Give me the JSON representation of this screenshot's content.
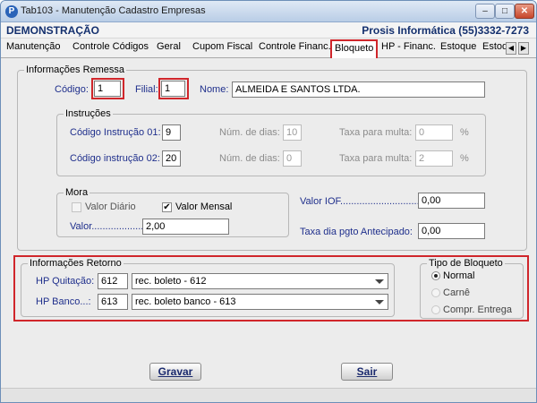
{
  "window": {
    "app_icon": "P",
    "title": "Tab103 - Manutenção Cadastro Empresas",
    "minimize": "–",
    "maximize": "□",
    "close": "✕"
  },
  "header": {
    "environment": "DEMONSTRAÇÃO",
    "company": "Prosis Informática (55)3332-7273"
  },
  "tabs": [
    {
      "label": "Manutenção"
    },
    {
      "label": "Controle Códigos"
    },
    {
      "label": "Geral"
    },
    {
      "label": "Cupom Fiscal"
    },
    {
      "label": "Controle Financ."
    },
    {
      "label": "Bloqueto"
    },
    {
      "label": "HP - Financ."
    },
    {
      "label": "Estoque"
    },
    {
      "label": "Estoq"
    }
  ],
  "tab_scroll": {
    "left": "◀",
    "right": "▶"
  },
  "remessa": {
    "legend": "Informações Remessa",
    "codigo_label": "Código:",
    "codigo_value": "1",
    "filial_label": "Filial:",
    "filial_value": "1",
    "nome_label": "Nome:",
    "nome_value": "ALMEIDA E SANTOS LTDA."
  },
  "instrucoes": {
    "legend": "Instruções",
    "rows": [
      {
        "label": "Código Instrução 01:",
        "codigo": "9",
        "dias_label": "Núm. de dias:",
        "dias": "10",
        "taxa_label": "Taxa para multa:",
        "taxa": "0",
        "percent": "%"
      },
      {
        "label": "Código instrução 02:",
        "codigo": "20",
        "dias_label": "Núm. de dias:",
        "dias": "0",
        "taxa_label": "Taxa para multa:",
        "taxa": "2",
        "percent": "%"
      }
    ]
  },
  "mora": {
    "legend": "Mora",
    "valor_diario_label": "Valor Diário",
    "valor_diario_checked": false,
    "valor_mensal_label": "Valor Mensal",
    "valor_mensal_checked": true,
    "check_mark": "✔",
    "valor_label": "Valor......................:",
    "valor_value": "2,00"
  },
  "iof": {
    "label": "Valor IOF.............................:",
    "value": "0,00",
    "taxa_label": "Taxa dia pgto Antecipado:",
    "taxa_value": "0,00"
  },
  "retorno": {
    "legend": "Informações Retorno",
    "quitacao_label": "HP Quitação:",
    "quitacao_code": "612",
    "quitacao_desc": "rec. boleto  - 612",
    "banco_label": "HP Banco...:",
    "banco_code": "613",
    "banco_desc": "rec. boleto banco - 613"
  },
  "tipo_bloqueto": {
    "legend": "Tipo de Bloqueto",
    "options": [
      {
        "label": "Normal",
        "selected": true
      },
      {
        "label": "Carnê",
        "selected": false
      },
      {
        "label": "Compr. Entrega",
        "selected": false
      }
    ]
  },
  "buttons": {
    "gravar": "Gravar",
    "sair": "Sair"
  },
  "colors": {
    "highlight": "#d0262b",
    "label_blue": "#1f2f8c",
    "header_navy": "#14306e"
  }
}
